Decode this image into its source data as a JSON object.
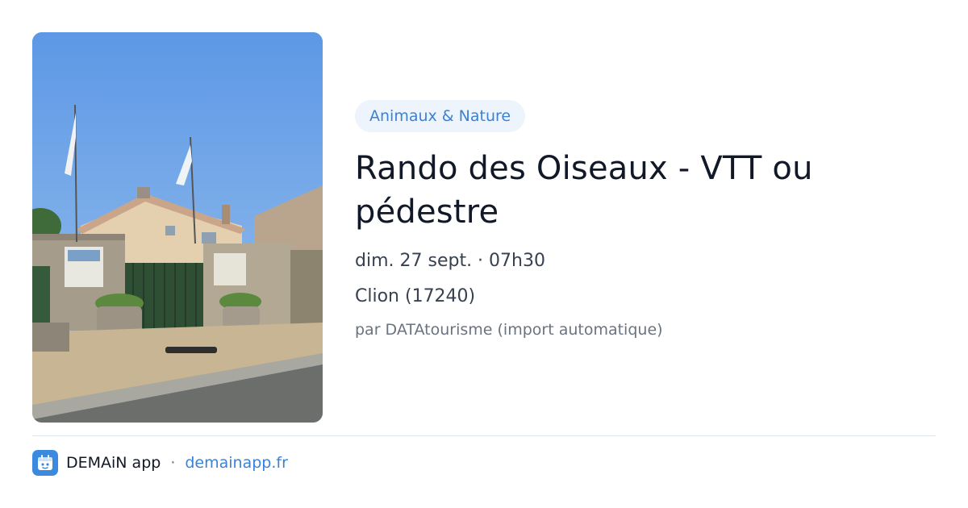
{
  "event": {
    "category": "Animaux & Nature",
    "title": "Rando des Oiseaux - VTT ou pédestre",
    "date": "dim. 27 sept. · 07h30",
    "place": "Clion (17240)",
    "source": "par DATAtourisme (import automatique)",
    "photo_description": "building-gate-with-flags"
  },
  "footer": {
    "app_name": "DEMAiN app",
    "separator": "·",
    "url": "demainapp.fr",
    "icon": "demain-app-icon"
  },
  "colors": {
    "accent": "#3b82d6",
    "badge_bg": "#eef4fb",
    "title": "#111827",
    "muted": "#6b7280"
  }
}
